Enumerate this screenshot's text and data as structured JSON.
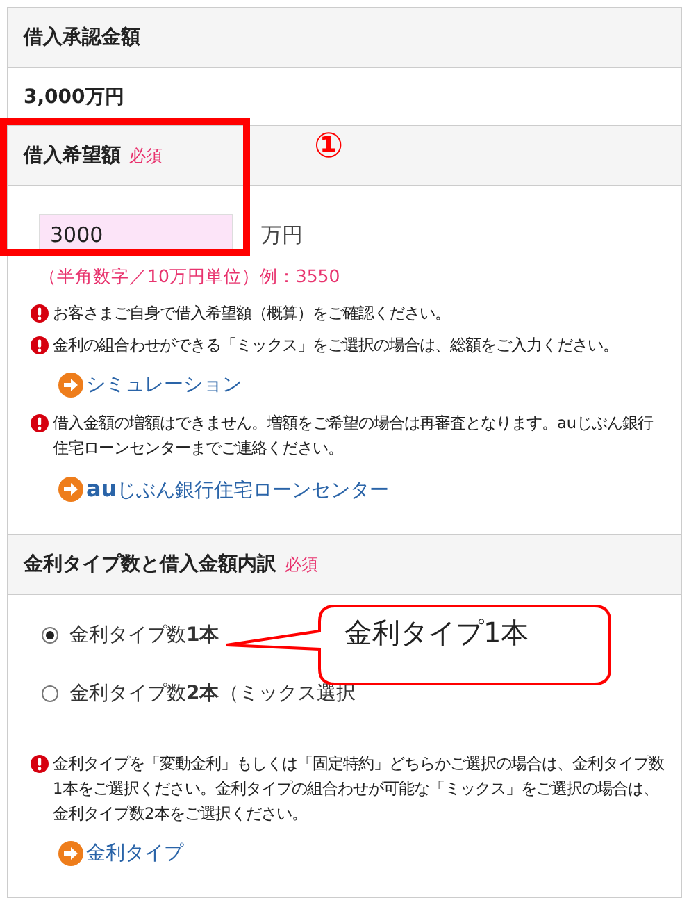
{
  "sections": [
    {
      "title": "借入承認金額",
      "kind": "value",
      "value": "3,000万円"
    },
    {
      "title": "借入希望額",
      "badge": "必須",
      "kind": "amount",
      "input": {
        "value": "3000",
        "unit": "万円",
        "hint": "（半角数字／10万円単位）例：3550"
      },
      "blocks": [
        {
          "kind": "note",
          "text": "お客さまご自身で借入希望額（概算）をご確認ください。"
        },
        {
          "kind": "note",
          "text": "金利の組合わせができる「ミックス」をご選択の場合は、総額をご入力ください。"
        },
        {
          "kind": "link",
          "text": "シミュレーション"
        },
        {
          "kind": "note",
          "text": "借入金額の増額はできません。増額をご希望の場合は再審査となります。auじぶん銀行住宅ローンセンターまでご連絡ください。"
        },
        {
          "kind": "link",
          "text": "**au**じぶん銀行住宅ローンセンター"
        }
      ]
    },
    {
      "title": "金利タイプ数と借入金額内訳",
      "badge": "必須",
      "kind": "choice",
      "options": [
        {
          "label": "金利タイプ数**1本**",
          "selected": true
        },
        {
          "label": "金利タイプ数**2本**（ミックス選択",
          "selected": false
        }
      ],
      "blocks": [
        {
          "kind": "note",
          "text": "金利タイプを「変動金利」もしくは「固定特約」どちらかご選択の場合は、金利タイプ数1本をご選択ください。金利タイプの組合わせが可能な「ミックス」をご選択の場合は、金利タイプ数2本をご選択ください。"
        },
        {
          "kind": "link",
          "text": "金利タイプ"
        }
      ]
    }
  ],
  "annotations": [
    {
      "kind": "frame"
    },
    {
      "kind": "number",
      "text": "①"
    },
    {
      "kind": "callout",
      "text": "金利タイプ1本"
    }
  ]
}
